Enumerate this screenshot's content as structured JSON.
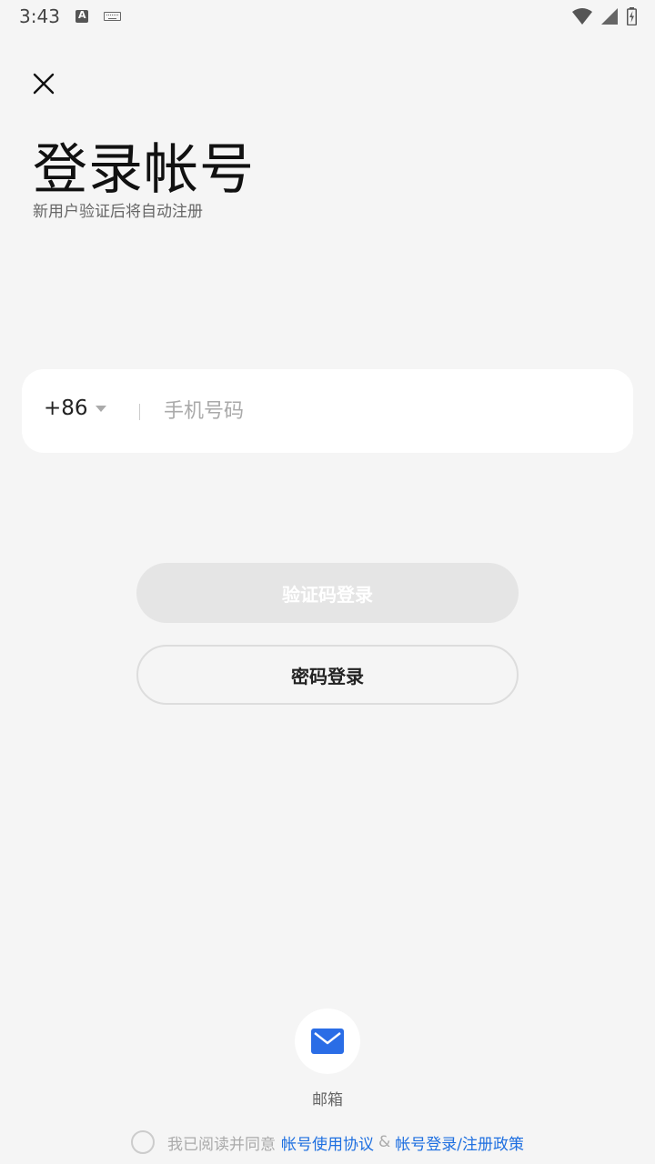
{
  "status_bar": {
    "time": "3:43"
  },
  "page": {
    "title": "登录帐号",
    "subtitle": "新用户验证后将自动注册"
  },
  "phone": {
    "country_code": "+86",
    "value": "",
    "placeholder": "手机号码"
  },
  "buttons": {
    "sms_login": "验证码登录",
    "password_login": "密码登录"
  },
  "alt_login": {
    "email_label": "邮箱"
  },
  "agreement": {
    "prefix": "我已阅读并同意",
    "user_agreement": "帐号使用协议",
    "amp": "&",
    "policy": "帐号登录/注册政策"
  },
  "colors": {
    "background": "#f5f5f5",
    "link": "#1e6fe0",
    "email_icon": "#2a6de6",
    "disabled_button": "#e5e5e5"
  },
  "icons": [
    "close-icon",
    "chevron-down-icon",
    "mail-icon",
    "wifi-icon",
    "signal-icon",
    "battery-icon"
  ]
}
